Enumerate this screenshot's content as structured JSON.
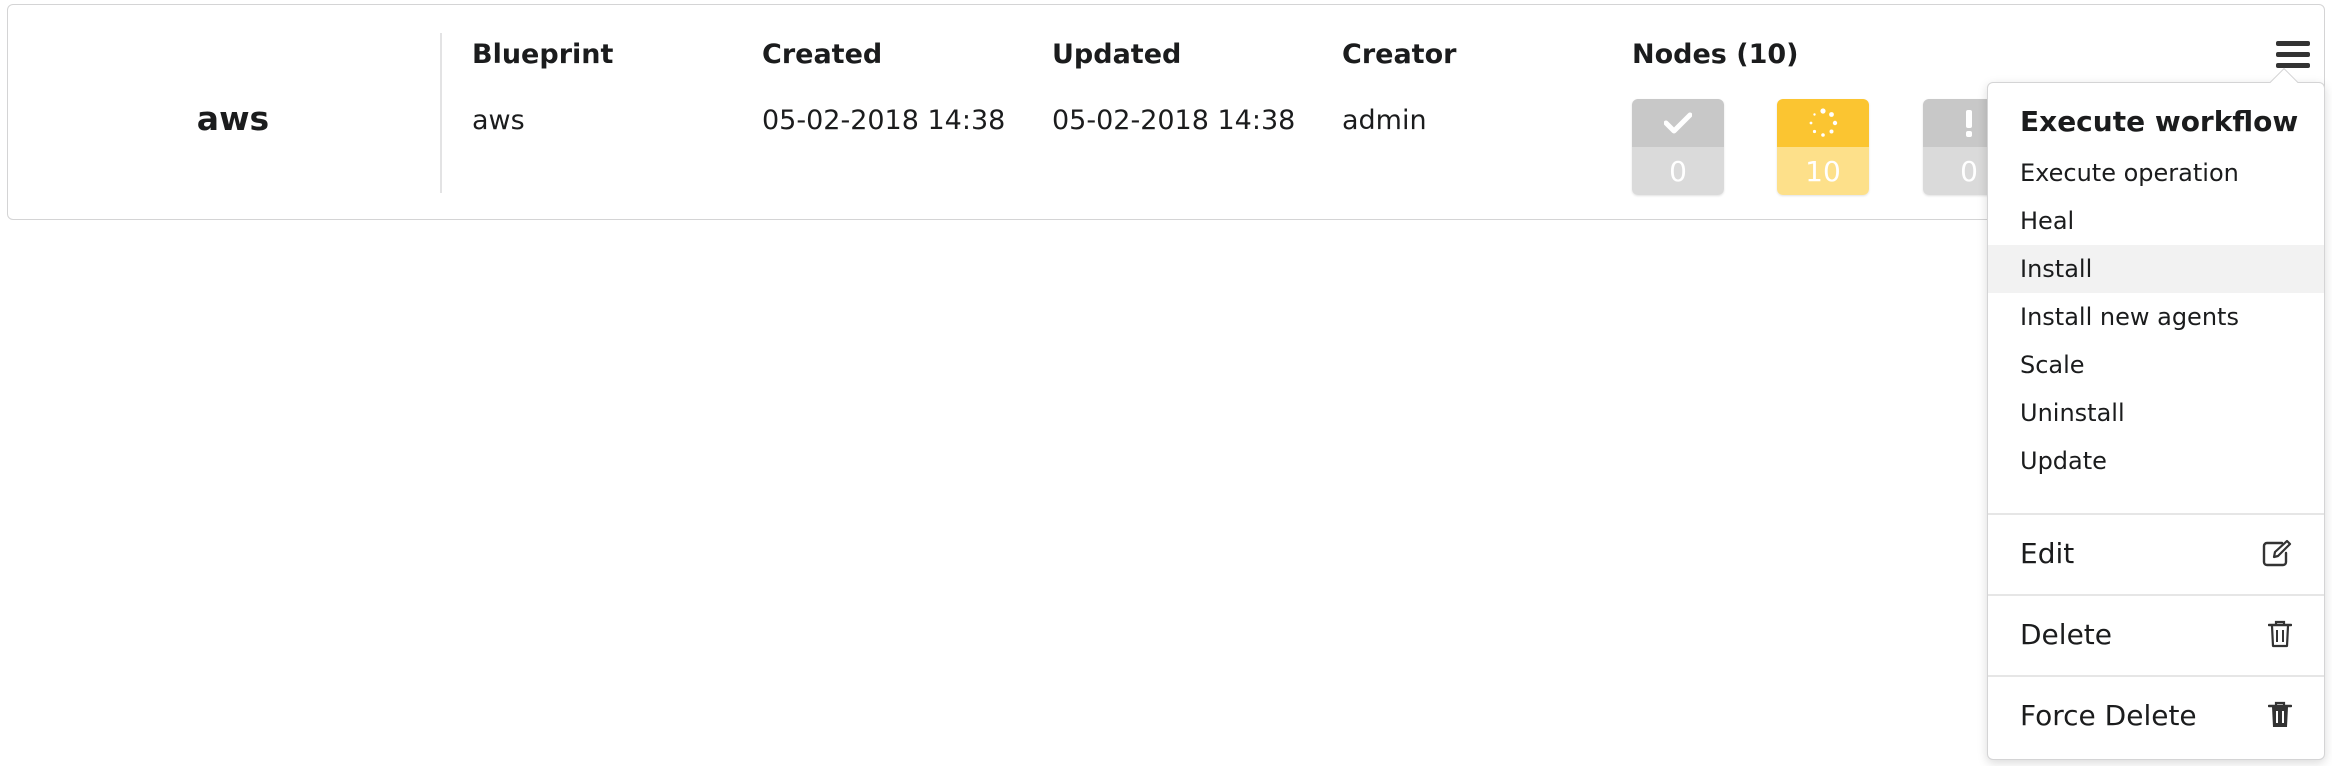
{
  "deployment": {
    "name": "aws",
    "columns": [
      {
        "header": "Blueprint",
        "value": "aws"
      },
      {
        "header": "Created",
        "value": "05-02-2018 14:38"
      },
      {
        "header": "Updated",
        "value": "05-02-2018 14:38"
      },
      {
        "header": "Creator",
        "value": "admin"
      }
    ],
    "nodes": {
      "header": "Nodes (10)",
      "states": [
        {
          "state": "started",
          "icon": "check-icon",
          "count": "0",
          "color": "#c8c8c8"
        },
        {
          "state": "in-progress",
          "icon": "spinner-icon",
          "count": "10",
          "color": "#fbc531"
        },
        {
          "state": "warning",
          "icon": "exclamation-icon",
          "count": "0",
          "color": "#c8c8c8"
        }
      ]
    }
  },
  "menu": {
    "icon": "hamburger-icon",
    "header": "Execute workflow",
    "workflows": [
      "Execute operation",
      "Heal",
      "Install",
      "Install new agents",
      "Scale",
      "Uninstall",
      "Update"
    ],
    "hovered": "Install",
    "actions": [
      {
        "label": "Edit",
        "icon": "edit-icon"
      },
      {
        "label": "Delete",
        "icon": "trash-icon"
      },
      {
        "label": "Force Delete",
        "icon": "trash-solid-icon"
      }
    ]
  }
}
